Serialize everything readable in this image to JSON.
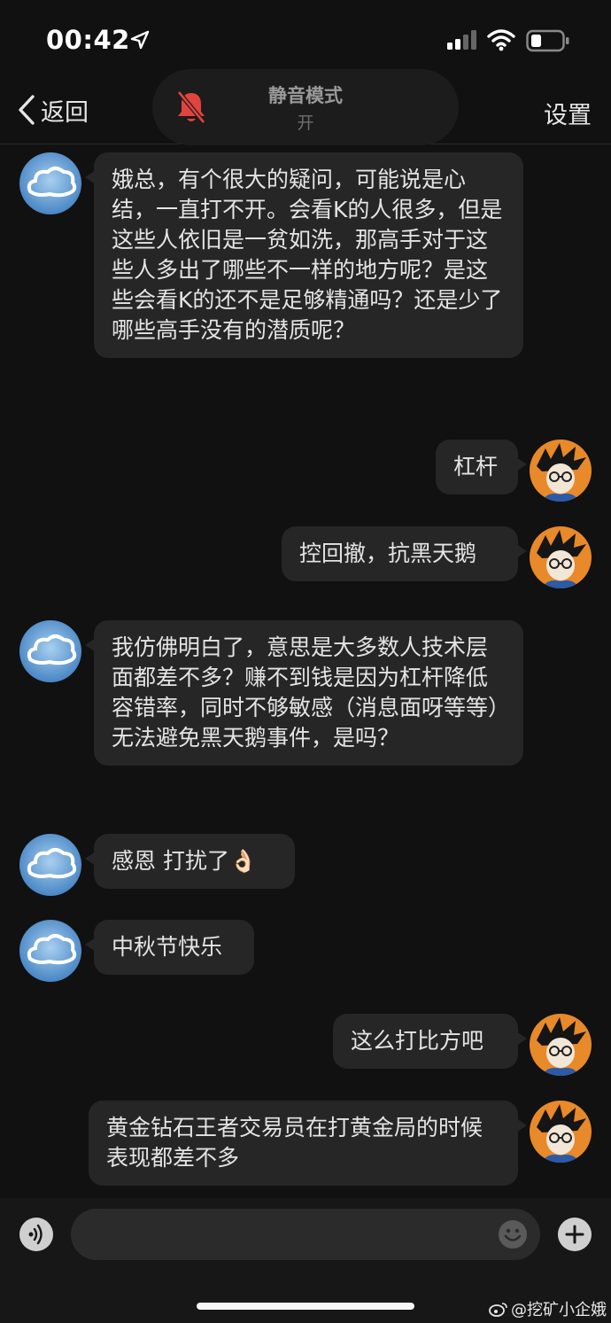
{
  "status_bar": {
    "time": "00:42"
  },
  "nav": {
    "back_label": "返回",
    "settings_label": "设置"
  },
  "mute_banner": {
    "title": "静音模式",
    "state": "开"
  },
  "messages": [
    {
      "side": "left",
      "text": "娥总，有个很大的疑问，可能说是心结，一直打不开。会看K的人很多，但是这些人依旧是一贫如洗，那高手对于这些人多出了哪些不一样的地方呢？是这些会看K的还不是足够精通吗？还是少了哪些高手没有的潜质呢？"
    },
    {
      "side": "right",
      "text": "杠杆"
    },
    {
      "side": "right",
      "text": "控回撤，抗黑天鹅"
    },
    {
      "side": "left",
      "text": "我仿佛明白了，意思是大多数人技术层面都差不多？赚不到钱是因为杠杆降低容错率，同时不够敏感（消息面呀等等）无法避免黑天鹅事件，是吗？"
    },
    {
      "side": "left",
      "text": "感恩 打扰了👌🏻"
    },
    {
      "side": "left",
      "text": "中秋节快乐"
    },
    {
      "side": "right",
      "text": "这么打比方吧"
    },
    {
      "side": "right",
      "text": "黄金钻石王者交易员在打黄金局的时候表现都差不多"
    }
  ],
  "input": {
    "placeholder": ""
  },
  "watermark": {
    "text": "@挖矿小企娥"
  }
}
